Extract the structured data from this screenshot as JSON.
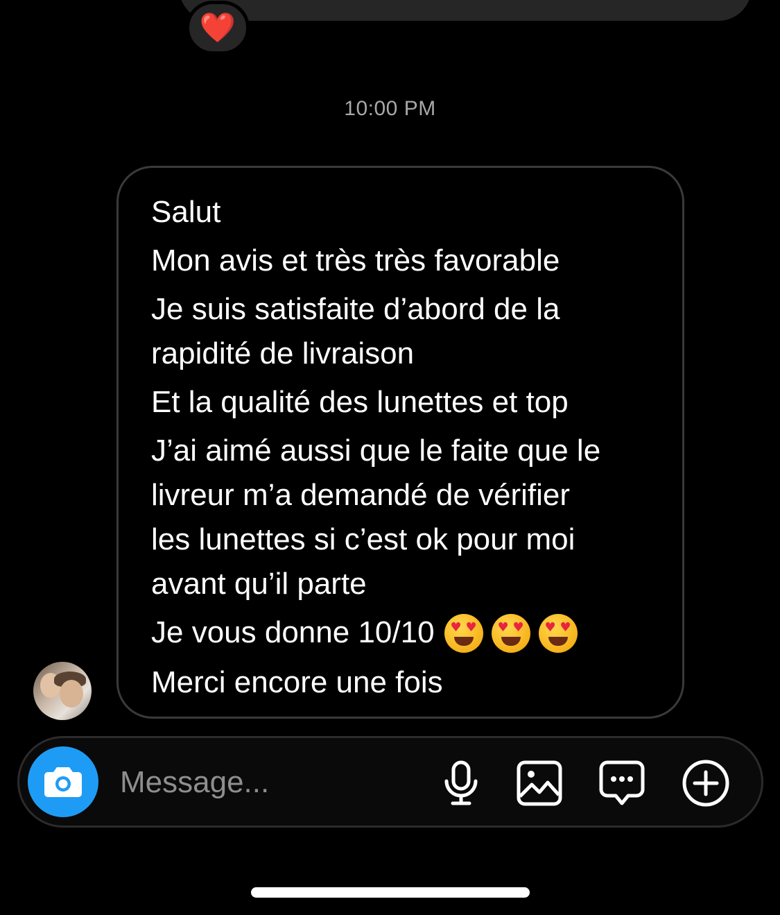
{
  "previous_message": {
    "reaction": "❤️"
  },
  "timestamp": "10:00 PM",
  "message": {
    "lines": [
      "Salut",
      "Mon avis et très très favorable",
      "Je suis satisfaite d’abord de la",
      "rapidité de livraison",
      "Et la qualité des lunettes et top",
      "J’ai aimé aussi que le faite que le",
      "livreur m’a demandé de vérifier",
      "les lunettes si c’est ok pour moi",
      "avant qu’il parte",
      "Je vous donne 10/10",
      "Merci encore une fois"
    ],
    "emoji_count": 3,
    "emoji": "heart-eyes-emoji"
  },
  "composer": {
    "placeholder": "Message...",
    "icons": [
      "camera-icon",
      "microphone-icon",
      "gallery-icon",
      "sticker-icon",
      "plus-icon"
    ]
  },
  "colors": {
    "background": "#000000",
    "accent": "#1e9cf5",
    "bubble_border": "#3a3a3a",
    "timestamp": "#a8a8a8"
  }
}
